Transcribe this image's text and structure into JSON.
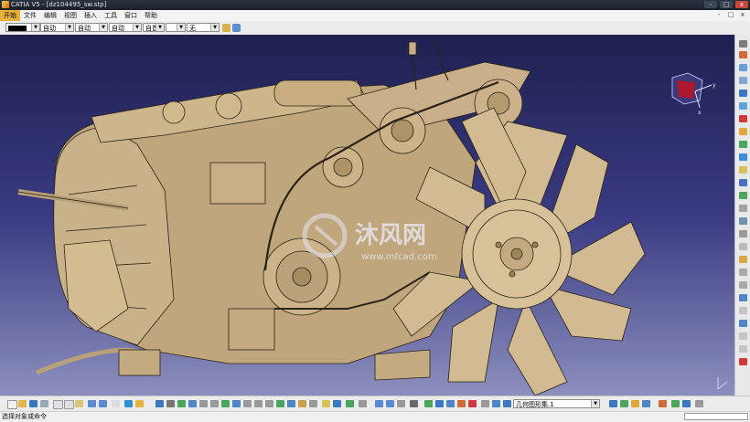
{
  "window": {
    "title": "CATIA V5 - [dz104495_sw.stp]",
    "controls": [
      "-",
      "□",
      "x"
    ]
  },
  "menubar": {
    "items": [
      "开始",
      "文件",
      "编辑",
      "视图",
      "插入",
      "工具",
      "窗口",
      "帮助"
    ],
    "active": "开始",
    "doc_controls": [
      "-",
      "□",
      "x"
    ]
  },
  "properties_toolbar": {
    "color_value": "",
    "transparency_value": "自动",
    "thickness_value": "自动",
    "linetype_value": "自动",
    "point_value": "自首",
    "layer_value": "无"
  },
  "viewport": {
    "watermark": {
      "brand": "沐风网",
      "url": "www.mfcad.com"
    },
    "compass_axes": [
      "x",
      "y",
      "z"
    ]
  },
  "bottom_toolbar": {
    "geometric_set_value": "几何图形集.1"
  },
  "statusbar": {
    "text": "选择对象或命令"
  },
  "colors": {
    "viewport_top": "#1f2050",
    "viewport_bottom": "#8c8fbd",
    "model_fill": "#c8b088",
    "model_edge": "#2a2418",
    "active_menu": "#e8b23a"
  }
}
